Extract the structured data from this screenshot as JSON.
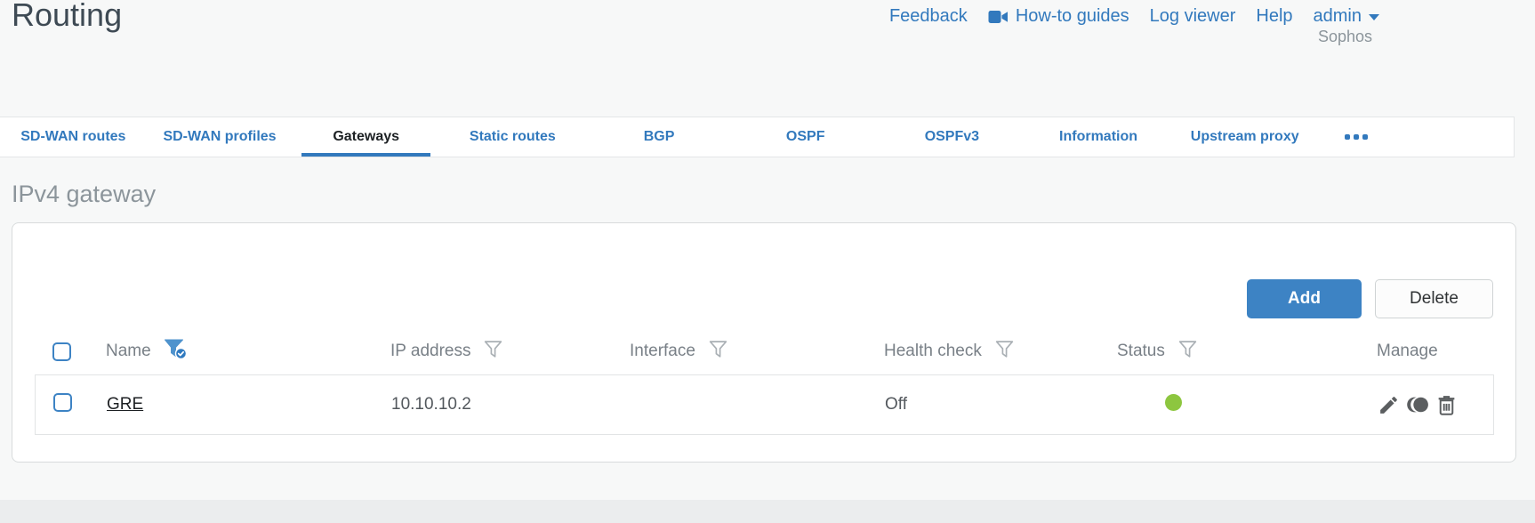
{
  "header": {
    "title": "Routing",
    "brand": "Sophos",
    "links": [
      {
        "label": "Feedback"
      },
      {
        "label": "How-to guides",
        "icon": "video-camera-icon"
      },
      {
        "label": "Log viewer"
      },
      {
        "label": "Help"
      },
      {
        "label": "admin",
        "icon": "caret-down-icon"
      }
    ]
  },
  "tabs": {
    "items": [
      {
        "label": "SD-WAN routes",
        "active": false
      },
      {
        "label": "SD-WAN profiles",
        "active": false
      },
      {
        "label": "Gateways",
        "active": true
      },
      {
        "label": "Static routes",
        "active": false
      },
      {
        "label": "BGP",
        "active": false
      },
      {
        "label": "OSPF",
        "active": false
      },
      {
        "label": "OSPFv3",
        "active": false
      },
      {
        "label": "Information",
        "active": false
      },
      {
        "label": "Upstream proxy",
        "active": false
      }
    ],
    "more_icon": "ellipsis-dots"
  },
  "section": {
    "title": "IPv4 gateway"
  },
  "toolbar": {
    "add_label": "Add",
    "delete_label": "Delete"
  },
  "table": {
    "columns": [
      {
        "label": "Name",
        "filter_icon": "funnel-check-icon",
        "filter_state": "active"
      },
      {
        "label": "IP address",
        "filter_icon": "funnel-icon",
        "filter_state": "inactive"
      },
      {
        "label": "Interface",
        "filter_icon": "funnel-icon",
        "filter_state": "inactive"
      },
      {
        "label": "Health check",
        "filter_icon": "funnel-icon",
        "filter_state": "inactive"
      },
      {
        "label": "Status",
        "filter_icon": "funnel-icon",
        "filter_state": "inactive"
      },
      {
        "label": "Manage"
      }
    ],
    "rows": [
      {
        "name": "GRE",
        "ip_address": "10.10.10.2",
        "interface": "",
        "health_check": "Off",
        "status_icon": "green-dot",
        "manage_icons": [
          "edit-pencil-icon",
          "deactivate-eclipse-icon",
          "trash-icon"
        ]
      }
    ]
  },
  "colors": {
    "accent_blue": "#3279bd",
    "button_blue": "#3d83c4",
    "status_green": "#8dc63f",
    "active_tab_text": "#1d2124",
    "muted_gray": "#8c959b"
  }
}
